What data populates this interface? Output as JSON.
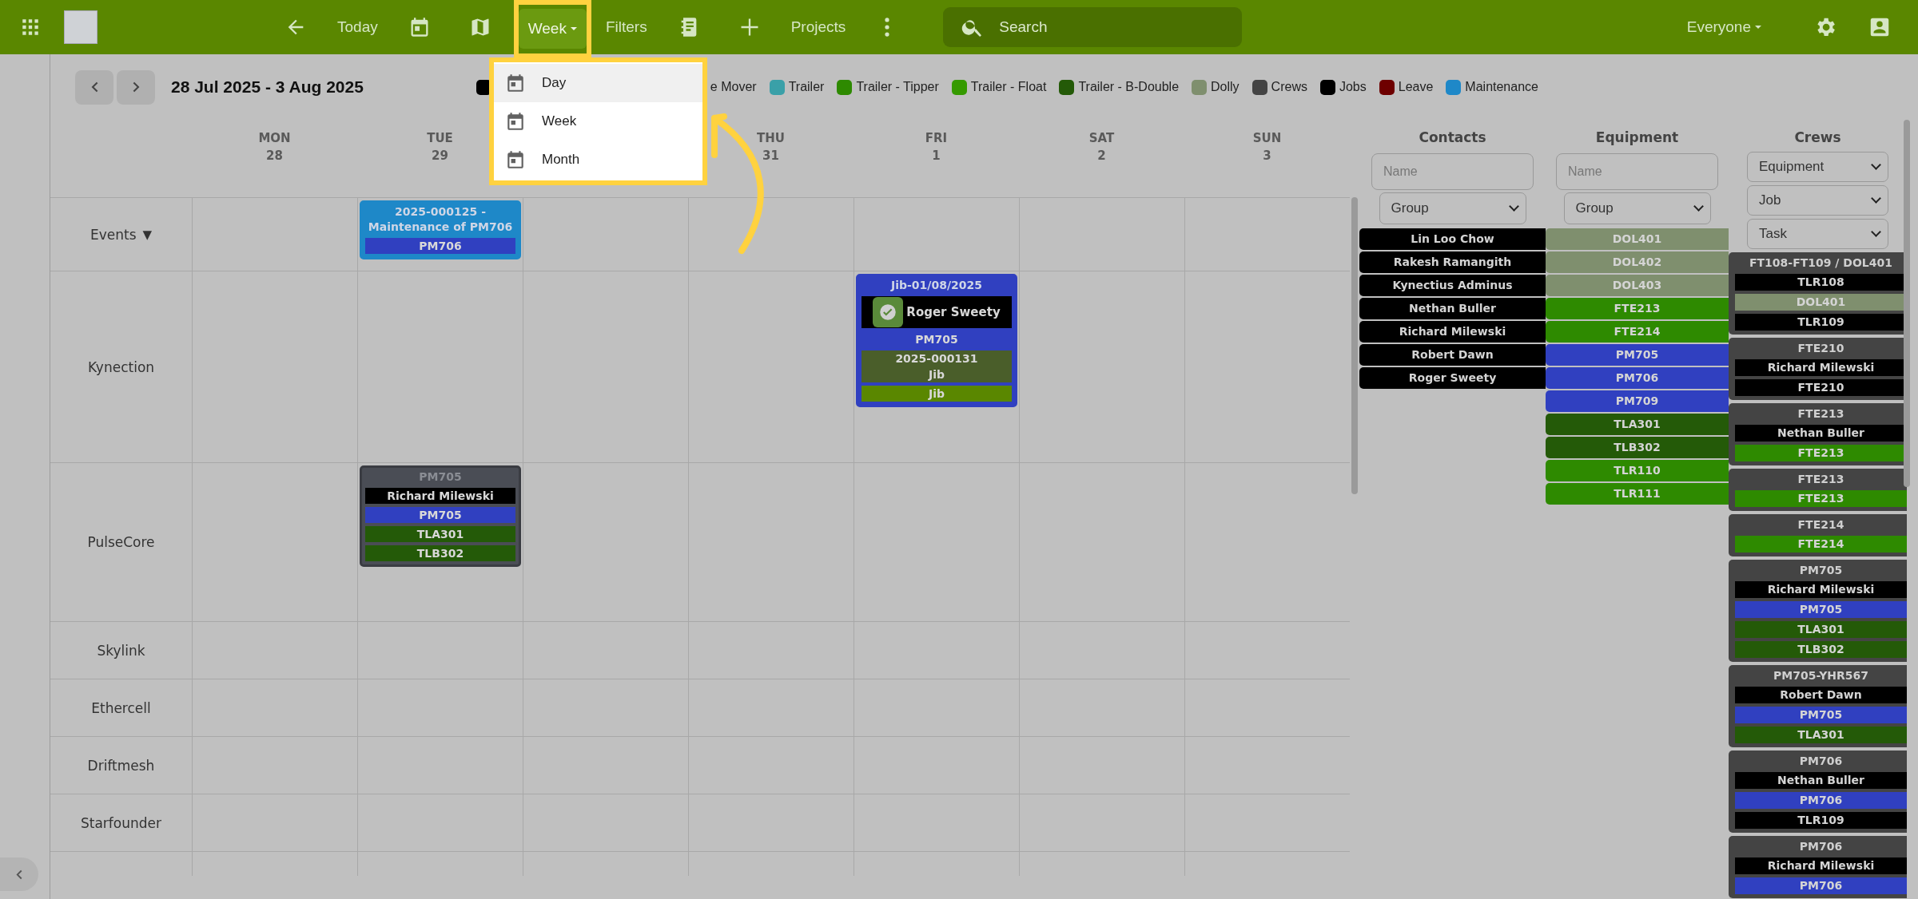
{
  "toolbar": {
    "items": [
      {
        "kind": "back"
      },
      {
        "kind": "text",
        "label": "Today"
      },
      {
        "kind": "calendar"
      },
      {
        "kind": "map"
      },
      {
        "kind": "dropdown",
        "label": "Week"
      },
      {
        "kind": "text",
        "label": "Filters"
      },
      {
        "kind": "notebook"
      },
      {
        "kind": "add"
      },
      {
        "kind": "text",
        "label": "Projects"
      },
      {
        "kind": "more"
      }
    ],
    "search": {
      "placeholder": "Search"
    },
    "audience": {
      "label": "Everyone"
    }
  },
  "week_menu": {
    "items": [
      {
        "label": "Day",
        "highlighted": true
      },
      {
        "label": "Week",
        "highlighted": false
      },
      {
        "label": "Month",
        "highlighted": false
      }
    ]
  },
  "date_range": "28 Jul 2025 - 3 Aug 2025",
  "legend": [
    {
      "kind": "swatch",
      "color": "#000000"
    },
    {
      "kind": "label",
      "label": "e Mover"
    },
    {
      "kind": "full",
      "label": "Trailer",
      "color": "#3aa0a8"
    },
    {
      "kind": "full",
      "label": "Trailer - Tipper",
      "color": "#2e8a00"
    },
    {
      "kind": "full",
      "label": "Trailer - Float",
      "color": "#359a00"
    },
    {
      "kind": "full",
      "label": "Trailer - B-Double",
      "color": "#245a08"
    },
    {
      "kind": "full",
      "label": "Dolly",
      "color": "#7f8f6e"
    },
    {
      "kind": "full",
      "label": "Crews",
      "color": "#444444"
    },
    {
      "kind": "full",
      "label": "Jobs",
      "color": "#000000"
    },
    {
      "kind": "full",
      "label": "Leave",
      "color": "#6e0000"
    },
    {
      "kind": "full",
      "label": "Maintenance",
      "color": "#1e88c8"
    }
  ],
  "calendar": {
    "days": [
      {
        "kind": "day",
        "name": "MON",
        "date": "28"
      },
      {
        "kind": "day",
        "name": "TUE",
        "date": "29"
      },
      {
        "kind": "covered"
      },
      {
        "kind": "day",
        "name": "THU",
        "date": "31"
      },
      {
        "kind": "day",
        "name": "FRI",
        "date": "1"
      },
      {
        "kind": "day",
        "name": "SAT",
        "date": "2"
      },
      {
        "kind": "day",
        "name": "SUN",
        "date": "3"
      }
    ],
    "rows": [
      {
        "label": "Events",
        "toggle": "▼",
        "cells": [
          null,
          {
            "kind": "maintenance",
            "color": "#1e88c8",
            "title": "2025-000125 - Maintenance of PM706",
            "lines": [
              {
                "text": "PM706",
                "color": "#3040c0",
                "confirmed": false
              }
            ]
          },
          null,
          null,
          null,
          null,
          null
        ]
      },
      {
        "label": "Kynection",
        "cells": [
          null,
          null,
          null,
          null,
          {
            "kind": "job",
            "color": "#3040c0",
            "title": "Jib-01/08/2025",
            "lines": [
              {
                "text": "Roger Sweety",
                "color": "#000000",
                "confirmed": true
              },
              {
                "text": "PM705",
                "confirmed": false
              },
              {
                "text": "2025-000131\nJib",
                "color": "#4a5e2a",
                "confirmed": false
              },
              {
                "text": "Jib",
                "color": "#5a8700",
                "confirmed": false
              }
            ]
          },
          null,
          null
        ]
      },
      {
        "label": "PulseCore",
        "cells": [
          null,
          {
            "kind": "pending",
            "color": "#4a4d55",
            "title": "PM705",
            "lines": [
              {
                "text": "Richard Milewski",
                "color": "#000000",
                "confirmed": false
              },
              {
                "text": "PM705",
                "color": "#3040c0",
                "confirmed": false
              },
              {
                "text": "TLA301",
                "color": "#245a08",
                "confirmed": false
              },
              {
                "text": "TLB302",
                "color": "#245a08",
                "confirmed": false
              }
            ]
          },
          null,
          null,
          null,
          null,
          null
        ]
      },
      {
        "label": "Skylink",
        "cells": [
          null,
          null,
          null,
          null,
          null,
          null,
          null
        ]
      },
      {
        "label": "Ethercell",
        "cells": [
          null,
          null,
          null,
          null,
          null,
          null,
          null
        ]
      },
      {
        "label": "Driftmesh",
        "cells": [
          null,
          null,
          null,
          null,
          null,
          null,
          null
        ]
      },
      {
        "label": "Starfounder",
        "cells": [
          null,
          null,
          null,
          null,
          null,
          null,
          null
        ]
      },
      {
        "cells": [
          null,
          null,
          null,
          null,
          null,
          null,
          null
        ]
      }
    ]
  },
  "contacts": {
    "title": "Contacts",
    "name_field": {
      "placeholder": "Name"
    },
    "group_select": {
      "value": "Group"
    },
    "items": [
      {
        "label": "Lin Loo Chow"
      },
      {
        "label": "Rakesh Ramangith"
      },
      {
        "label": "Kynectius Adminus"
      },
      {
        "label": "Nethan Buller"
      },
      {
        "label": "Richard Milewski"
      },
      {
        "label": "Robert Dawn"
      },
      {
        "label": "Roger Sweety"
      }
    ]
  },
  "equipment": {
    "title": "Equipment",
    "name_field": {
      "placeholder": "Name"
    },
    "group_select": {
      "value": "Group"
    },
    "items": [
      {
        "label": "DOL401",
        "color": "#7f8f6e"
      },
      {
        "label": "DOL402",
        "color": "#7f8f6e"
      },
      {
        "label": "DOL403",
        "color": "#7f8f6e"
      },
      {
        "label": "FTE213",
        "color": "#2e8a00"
      },
      {
        "label": "FTE214",
        "color": "#2e8a00"
      },
      {
        "label": "PM705",
        "color": "#3040c0"
      },
      {
        "label": "PM706",
        "color": "#3040c0"
      },
      {
        "label": "PM709",
        "color": "#3040c0"
      },
      {
        "label": "TLA301",
        "color": "#245a08"
      },
      {
        "label": "TLB302",
        "color": "#245a08"
      },
      {
        "label": "TLR110",
        "color": "#2e8a00"
      },
      {
        "label": "TLR111",
        "color": "#2e8a00"
      }
    ]
  },
  "crews": {
    "title": "Crews",
    "filters": [
      {
        "value": "Equipment"
      },
      {
        "value": "Job"
      },
      {
        "value": "Task"
      }
    ],
    "groups": [
      {
        "title": "FT108-FT109 / DOL401",
        "items": [
          {
            "label": "TLR108",
            "color": "#000000"
          },
          {
            "label": "DOL401",
            "color": "#7f8f6e"
          },
          {
            "label": "TLR109",
            "color": "#000000"
          }
        ]
      },
      {
        "title": "FTE210",
        "items": [
          {
            "label": "Richard Milewski",
            "color": "#000000"
          },
          {
            "label": "FTE210",
            "color": "#000000"
          }
        ]
      },
      {
        "title": "FTE213",
        "items": [
          {
            "label": "Nethan Buller",
            "color": "#000000"
          },
          {
            "label": "FTE213",
            "color": "#2e8a00"
          }
        ]
      },
      {
        "title": "FTE213",
        "items": [
          {
            "label": "FTE213",
            "color": "#2e8a00"
          }
        ]
      },
      {
        "title": "FTE214",
        "items": [
          {
            "label": "FTE214",
            "color": "#2e8a00"
          }
        ]
      },
      {
        "title": "PM705",
        "items": [
          {
            "label": "Richard Milewski",
            "color": "#000000"
          },
          {
            "label": "PM705",
            "color": "#3040c0"
          },
          {
            "label": "TLA301",
            "color": "#245a08"
          },
          {
            "label": "TLB302",
            "color": "#245a08"
          }
        ]
      },
      {
        "title": "PM705-YHR567",
        "items": [
          {
            "label": "Robert Dawn",
            "color": "#000000"
          },
          {
            "label": "PM705",
            "color": "#3040c0"
          },
          {
            "label": "TLA301",
            "color": "#245a08"
          }
        ]
      },
      {
        "title": "PM706",
        "items": [
          {
            "label": "Nethan Buller",
            "color": "#000000"
          },
          {
            "label": "PM706",
            "color": "#3040c0"
          },
          {
            "label": "TLR109",
            "color": "#000000"
          }
        ]
      },
      {
        "title": "PM706",
        "items": [
          {
            "label": "Richard Milewski",
            "color": "#000000"
          },
          {
            "label": "PM706",
            "color": "#3040c0"
          }
        ]
      }
    ]
  }
}
